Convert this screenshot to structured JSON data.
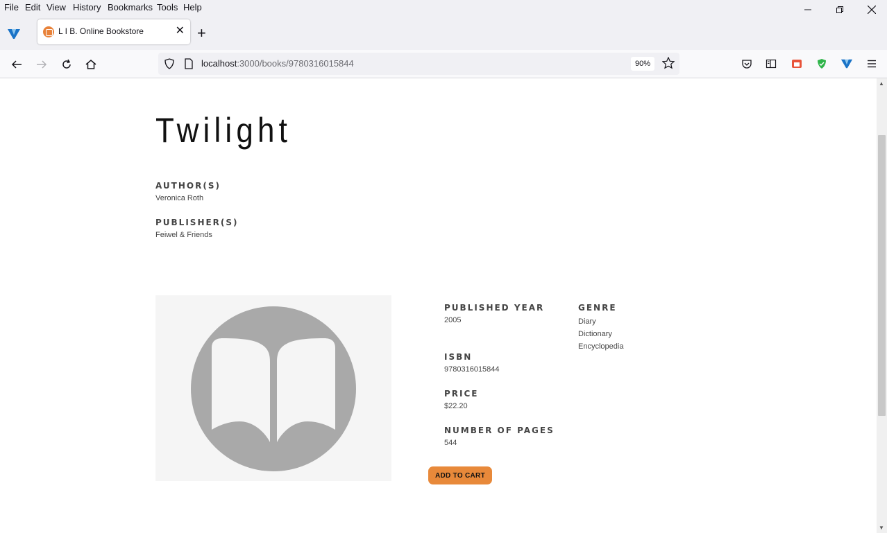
{
  "menubar": {
    "items": [
      "File",
      "Edit",
      "View",
      "History",
      "Bookmarks",
      "Tools",
      "Help"
    ]
  },
  "tab": {
    "title": "L I B. Online Bookstore",
    "close": "✕",
    "new_tab": "+"
  },
  "urlbar": {
    "host": "localhost",
    "path": ":3000/books/9780316015844",
    "zoom": "90%"
  },
  "book": {
    "title": "Twilight",
    "authors_label": "AUTHOR(S)",
    "authors": "Veronica Roth",
    "publishers_label": "PUBLISHER(S)",
    "publishers": "Feiwel & Friends",
    "published_year_label": "PUBLISHED YEAR",
    "published_year": "2005",
    "genre_label": "GENRE",
    "genres": [
      "Diary",
      "Dictionary",
      "Encyclopedia"
    ],
    "isbn_label": "ISBN",
    "isbn": "9780316015844",
    "price_label": "PRICE",
    "price": "$22.20",
    "pages_label": "NUMBER OF PAGES",
    "pages": "544",
    "add_to_cart": "ADD TO CART"
  },
  "colors": {
    "accent": "#e8893a",
    "cover_bg": "#f5f5f5",
    "cover_icon": "#a9a9a9"
  }
}
